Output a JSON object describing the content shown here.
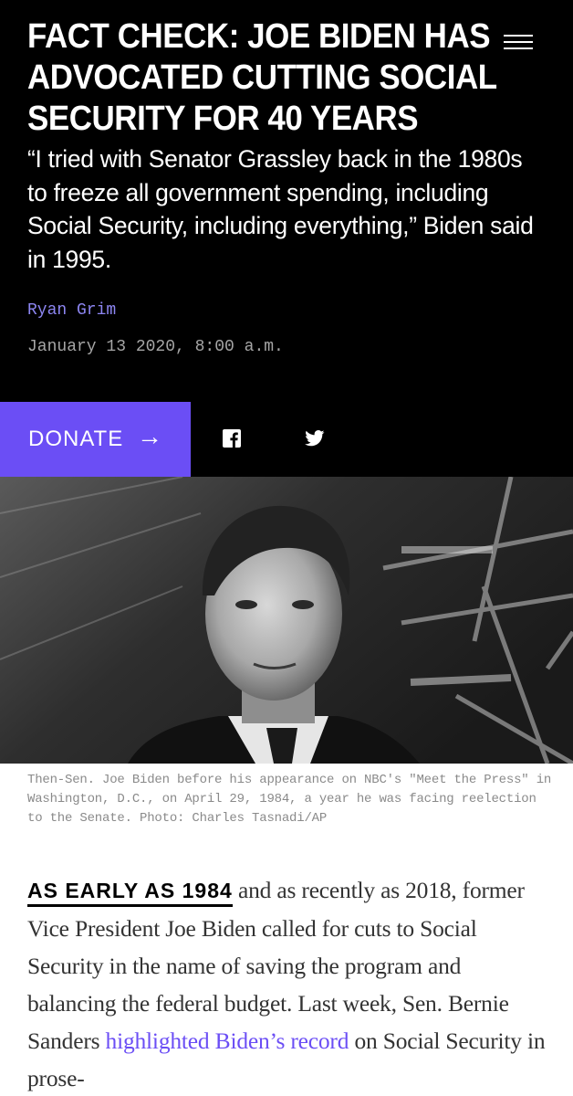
{
  "article": {
    "headline": "FACT CHECK: JOE BIDEN HAS ADVOCATED CUTTING SOCIAL SECURITY FOR 40 YEARS",
    "subhead": "“I tried with Senator Grassley back in the 1980s to freeze all government spending, including Social Security, including everything,” Biden said in 1995.",
    "author": "Ryan Grim",
    "date": "January 13 2020, 8:00 a.m."
  },
  "share_bar": {
    "donate_label": "DONATE",
    "donate_arrow": "→",
    "icons": [
      "facebook-icon",
      "twitter-icon"
    ]
  },
  "photo": {
    "caption": "Then-Sen. Joe Biden before his appearance on NBC's \"Meet the Press\" in Washington, D.C., on April 29, 1984, a year he was facing reelection to the Senate. Photo: Charles Tasnadi/AP"
  },
  "body": {
    "lead_in": "AS EARLY AS 1984",
    "text_1": " and as recently as 2018, former Vice President Joe Biden called for cuts to Social Security in the name of saving the program and balancing the federal bud­get. Last week, Sen. Bernie Sanders ",
    "link_text": "highlight­ed Biden’s record",
    "text_2": " on Social Security in prose-"
  },
  "colors": {
    "background_dark": "#000000",
    "accent_purple": "#6b4ef5",
    "byline_purple": "#8d86f2"
  }
}
